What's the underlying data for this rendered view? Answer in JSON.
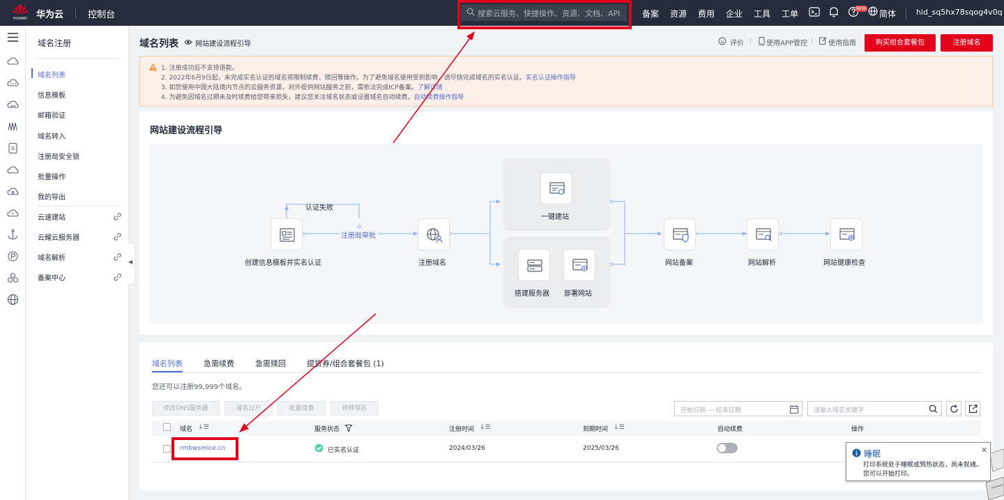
{
  "topbar": {
    "logo_text": "HUAWEI",
    "brand": "华为云",
    "console": "控制台",
    "search_placeholder": "搜索云服务、快捷操作、资源、文档、API",
    "nav": [
      "备案",
      "资源",
      "费用",
      "企业",
      "工具",
      "工单"
    ],
    "new_badge": "NEW",
    "language": "简体",
    "user": "hid_sq5hx78sqog4v0q"
  },
  "menu": {
    "title": "域名注册",
    "items": [
      "域名列表",
      "信息模板",
      "邮箱验证",
      "域名转入",
      "注册局安全锁",
      "批量操作",
      "我的导出"
    ],
    "links": [
      "云速建站",
      "云耀云服务器",
      "域名解析",
      "备案中心"
    ]
  },
  "header": {
    "title": "域名列表",
    "guide_link": "网站建设流程引导",
    "rate": "评价",
    "app": "使用APP管控",
    "guide": "使用指南",
    "buy_button": "购买组合套餐包",
    "register_button": "注册域名"
  },
  "notice": {
    "lines": [
      "1. 注册成功后不支持退款。",
      "2. 2022年6月9日起，未完成实名认证的域名将限制续费、赎回等操作。为了避免域名使用受到影响，请尽快完成域名的实名认证。",
      "3. 如您使用中国大陆境内节点的云服务资源，对外提供网站服务之前，需依法完成ICP备案。",
      "4. 为避免因域名过期未及时续费给您带来损失，建议您关注域名状态或设置域名自动续费。"
    ],
    "link2": "实名认证操作指导",
    "link3": "了解详情",
    "link4": "自动续费操作指导"
  },
  "flow": {
    "title": "网站建设流程引导",
    "fail_label": "认证失败",
    "review_label": "注册局审批",
    "steps": {
      "template": "创建信息模板并实名认证",
      "register": "注册域名",
      "oneclick": "一键建站",
      "server": "搭建服务器",
      "deploy": "部署网站",
      "icp": "网站备案",
      "dns": "网站解析",
      "health": "网站健康检查"
    }
  },
  "list": {
    "tabs": [
      "域名列表",
      "急需续费",
      "急需赎回",
      "提货券/组合套餐包 (1)"
    ],
    "hint": "您还可以注册99,999个域名。",
    "buttons": [
      "修改DNS服务器",
      "域名过户",
      "批量续费",
      "转移域名"
    ],
    "date_placeholder": "开始日期 — 结束日期",
    "keyword_placeholder": "请输入域名关键字",
    "columns": [
      "域名",
      "服务状态",
      "注册时间",
      "到期时间",
      "自动续费",
      "操作"
    ],
    "rows": [
      {
        "domain": "rmbwsmice.cn",
        "status": "已实名认证",
        "reg_date": "2024/03/26",
        "exp_date": "2025/03/26"
      }
    ]
  },
  "popup": {
    "title": "睡眠",
    "line1": "打印系统处于睡眠或预热状态，尚未就绪。",
    "line2": "您可以开始打印。"
  },
  "colors": {
    "accent": "#526ecc",
    "brand_red": "#e2001a",
    "topbar": "#252b3a",
    "annotation": "#e2001a"
  }
}
